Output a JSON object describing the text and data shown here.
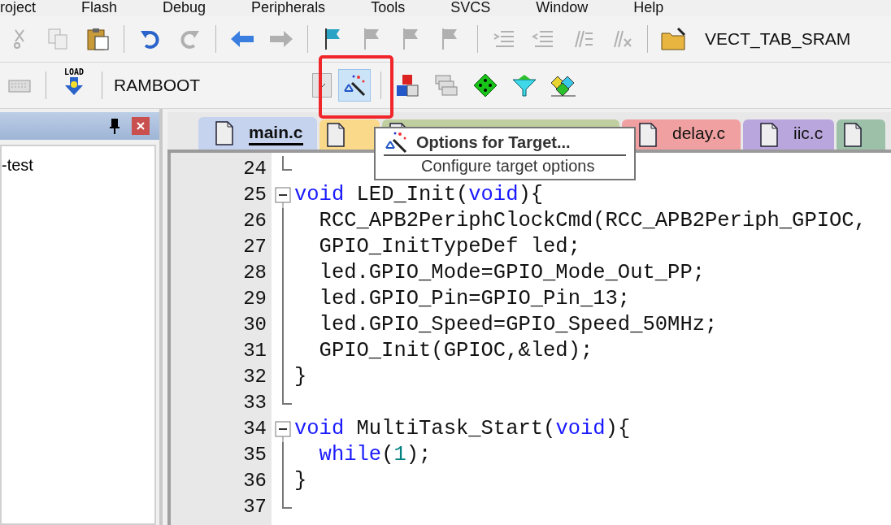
{
  "menu": [
    "roject",
    "Flash",
    "Debug",
    "Peripherals",
    "Tools",
    "SVCS",
    "Window",
    "Help"
  ],
  "toolbar_1": [
    [
      {
        "kind": "cut",
        "disabled": true
      },
      {
        "kind": "copy",
        "disabled": true
      },
      {
        "kind": "paste",
        "disabled": false
      }
    ],
    [
      {
        "kind": "undo",
        "disabled": false
      },
      {
        "kind": "redo",
        "disabled": true
      }
    ],
    [
      {
        "kind": "back",
        "disabled": false
      },
      {
        "kind": "forward",
        "disabled": true
      }
    ],
    [
      {
        "kind": "flag",
        "disabled": false
      },
      {
        "kind": "flag",
        "disabled": true
      },
      {
        "kind": "flag",
        "disabled": true
      },
      {
        "kind": "flag",
        "disabled": true
      }
    ],
    [
      {
        "kind": "indent",
        "disabled": true
      },
      {
        "kind": "outdent",
        "disabled": true
      },
      {
        "kind": "comment",
        "disabled": true
      },
      {
        "kind": "uncomment",
        "disabled": true
      }
    ],
    [
      {
        "kind": "folder",
        "disabled": false
      }
    ]
  ],
  "find_text": "VECT_TAB_SRAM",
  "toolbar_2": {
    "load_label": "LOAD",
    "target": "RAMBOOT",
    "options_button": {
      "selected": true,
      "highlighted": true
    },
    "icons": [
      {
        "kind": "manage"
      },
      {
        "kind": "batch"
      },
      {
        "kind": "diamond"
      },
      {
        "kind": "funnel"
      },
      {
        "kind": "packs"
      }
    ]
  },
  "project_panel": {
    "items": [
      "-test"
    ]
  },
  "tabs": [
    {
      "label": "main.c",
      "selected": true,
      "color": "#c5d3ef"
    },
    {
      "selected": false,
      "color": "#fbd98a"
    },
    {
      "selected": false,
      "color": "#c0cfa0"
    },
    {
      "label": "delay.c",
      "selected": false,
      "color": "#f0a0a0"
    },
    {
      "label": "iic.c",
      "selected": false,
      "color": "#b9a6dc"
    },
    {
      "selected": false,
      "color": "#9dc0a8"
    }
  ],
  "code": [
    {
      "line": "24",
      "kind": "fold_end"
    },
    {
      "line": "25",
      "kind": "fold_start",
      "tokens": [
        {
          "kind": "kw",
          "text": "void"
        },
        {
          "kind": "text",
          "text": " LED_Init("
        },
        {
          "kind": "kw",
          "text": "void"
        },
        {
          "kind": "text",
          "text": "){"
        }
      ]
    },
    {
      "line": "26",
      "kind": "fold_body",
      "tokens": [
        {
          "kind": "text",
          "text": "  RCC_APB2PeriphClockCmd(RCC_APB2Periph_GPIOC,"
        }
      ]
    },
    {
      "line": "27",
      "kind": "fold_body",
      "tokens": [
        {
          "kind": "text",
          "text": "  GPIO_InitTypeDef led;"
        }
      ]
    },
    {
      "line": "28",
      "kind": "fold_body",
      "tokens": [
        {
          "kind": "text",
          "text": "  led.GPIO_Mode=GPIO_Mode_Out_PP;"
        }
      ]
    },
    {
      "line": "29",
      "kind": "fold_body",
      "tokens": [
        {
          "kind": "text",
          "text": "  led.GPIO_Pin=GPIO_Pin_13;"
        }
      ]
    },
    {
      "line": "30",
      "kind": "fold_body",
      "tokens": [
        {
          "kind": "text",
          "text": "  led.GPIO_Speed=GPIO_Speed_50MHz;"
        }
      ]
    },
    {
      "line": "31",
      "kind": "fold_body",
      "tokens": [
        {
          "kind": "text",
          "text": "  GPIO_Init(GPIOC,&led);"
        }
      ]
    },
    {
      "line": "32",
      "kind": "fold_body",
      "tokens": [
        {
          "kind": "text",
          "text": "}"
        }
      ]
    },
    {
      "line": "33",
      "kind": "fold_end"
    },
    {
      "line": "34",
      "kind": "fold_start",
      "tokens": [
        {
          "kind": "kw",
          "text": "void"
        },
        {
          "kind": "text",
          "text": " MultiTask_Start("
        },
        {
          "kind": "kw",
          "text": "void"
        },
        {
          "kind": "text",
          "text": "){"
        }
      ]
    },
    {
      "line": "35",
      "kind": "fold_body",
      "tokens": [
        {
          "kind": "kw",
          "text": "  while"
        },
        {
          "kind": "text",
          "text": "("
        },
        {
          "kind": "num",
          "text": "1"
        },
        {
          "kind": "text",
          "text": ");"
        }
      ]
    },
    {
      "line": "36",
      "kind": "fold_body",
      "tokens": [
        {
          "kind": "text",
          "text": "}"
        }
      ]
    },
    {
      "line": "37",
      "kind": "fold_end"
    }
  ],
  "tooltip": {
    "title": "Options for Target...",
    "description": "Configure target options"
  }
}
